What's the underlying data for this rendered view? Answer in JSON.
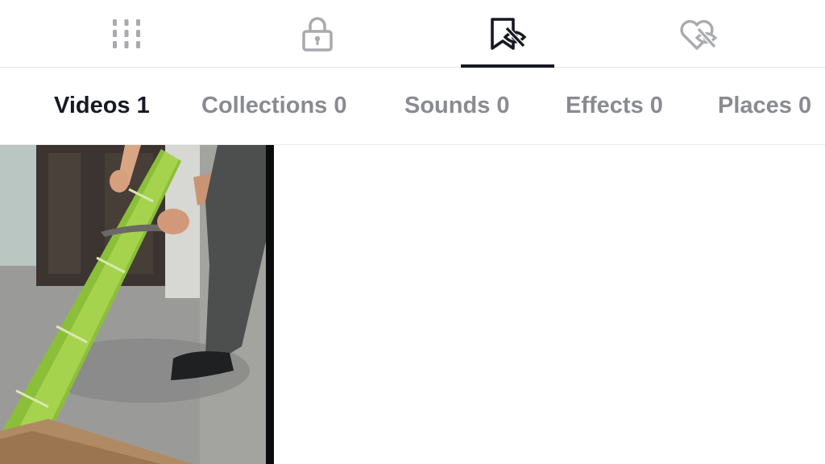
{
  "top_tabs": [
    {
      "icon": "grid-icon",
      "active": false
    },
    {
      "icon": "lock-icon",
      "active": false
    },
    {
      "icon": "bookmark-hidden-icon",
      "active": true
    },
    {
      "icon": "heart-hidden-icon",
      "active": false
    }
  ],
  "sub_tabs": [
    {
      "label": "Videos 1",
      "active": true
    },
    {
      "label": "Collections 0",
      "active": false
    },
    {
      "label": "Sounds 0",
      "active": false
    },
    {
      "label": "Effects 0",
      "active": false
    },
    {
      "label": "Places 0",
      "active": false
    }
  ],
  "colors": {
    "active_text": "#161823",
    "inactive_text": "#8a8b91",
    "icon_inactive": "#a9aaae",
    "underline": "#161823"
  },
  "videos": [
    {
      "thumbnail": "bamboo-cutting-video-thumbnail"
    }
  ]
}
